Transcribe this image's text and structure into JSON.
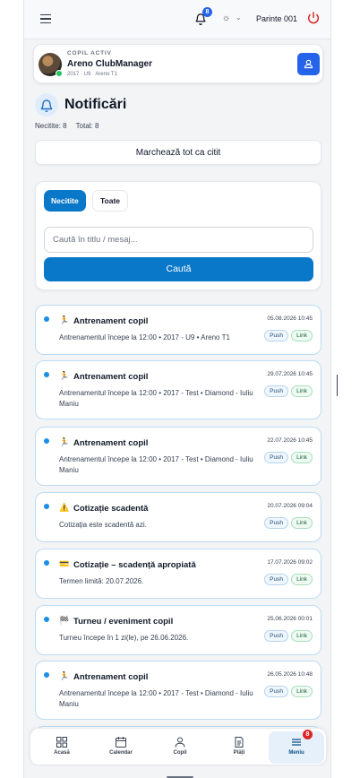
{
  "header": {
    "notification_count": "8",
    "user_name": "Parinte 001"
  },
  "active_child": {
    "kicker": "COPIL ACTIV",
    "name": "Areno ClubManager",
    "meta": "2017 · U9 · Areno T1"
  },
  "page": {
    "title": "Notificări",
    "unread_label": "Necitite: 8",
    "total_label": "Total: 8",
    "mark_all_label": "Marchează tot ca citit"
  },
  "filters": {
    "tab_unread": "Necitite",
    "tab_all": "Toate",
    "search_placeholder": "Caută în titlu / mesaj...",
    "search_button": "Caută"
  },
  "notifications": [
    {
      "icon": "🏃",
      "title": "Antrenament copil",
      "body": "Antrenamentul începe la 12:00 • 2017 - U9 • Areno T1",
      "time": "05.08.2026 10:45",
      "push": "Push",
      "link": "Link"
    },
    {
      "icon": "🏃",
      "title": "Antrenament copil",
      "body": "Antrenamentul începe la 12:00 • 2017 - Test • Diamond - Iuliu Maniu",
      "time": "29.07.2026 10:45",
      "push": "Push",
      "link": "Link"
    },
    {
      "icon": "🏃",
      "title": "Antrenament copil",
      "body": "Antrenamentul începe la 12:00 • 2017 - Test • Diamond - Iuliu Maniu",
      "time": "22.07.2026 10:45",
      "push": "Push",
      "link": "Link"
    },
    {
      "icon": "⚠️",
      "title": "Cotizație scadentă",
      "body": "Cotizația este scadentă azi.",
      "time": "20.07.2026 09:04",
      "push": "Push",
      "link": "Link"
    },
    {
      "icon": "💳",
      "title": "Cotizație – scadență apropiată",
      "body": "Termen limită: 20.07.2026.",
      "time": "17.07.2026 09:02",
      "push": "Push",
      "link": "Link"
    },
    {
      "icon": "🏁",
      "title": "Turneu / eveniment copil",
      "body": "Turneu începe în 1 zi(le), pe 26.06.2026.",
      "time": "25.06.2026 00:01",
      "push": "Push",
      "link": "Link"
    },
    {
      "icon": "🏃",
      "title": "Antrenament copil",
      "body": "Antrenamentul începe la 12:00 • 2017 - Test • Diamond - Iuliu Maniu",
      "time": "26.05.2026 10:48",
      "push": "Push",
      "link": "Link"
    }
  ],
  "bottom_nav": {
    "home": "Acasă",
    "calendar": "Calendar",
    "child": "Copil",
    "payments": "Plăți",
    "menu": "Meniu",
    "menu_badge": "8"
  },
  "colors": {
    "primary": "#0a78c8",
    "accent_blue": "#2563eb",
    "unread_dot": "#1d8ee6",
    "danger": "#dc2626"
  }
}
